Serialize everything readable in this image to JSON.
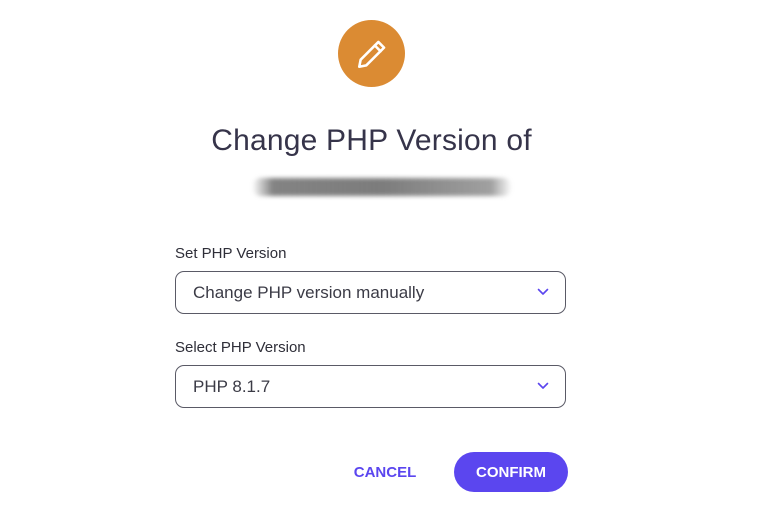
{
  "dialog": {
    "title": "Change PHP Version of",
    "header_icon": "pencil-icon",
    "accent_color": "#db8b33",
    "primary_color": "#5b46ef"
  },
  "fields": {
    "set_version": {
      "label": "Set PHP Version",
      "value": "Change PHP version manually",
      "icon": "chevron-down-icon"
    },
    "select_version": {
      "label": "Select PHP Version",
      "value": "PHP 8.1.7",
      "icon": "chevron-down-icon"
    }
  },
  "actions": {
    "cancel_label": "CANCEL",
    "confirm_label": "CONFIRM"
  }
}
